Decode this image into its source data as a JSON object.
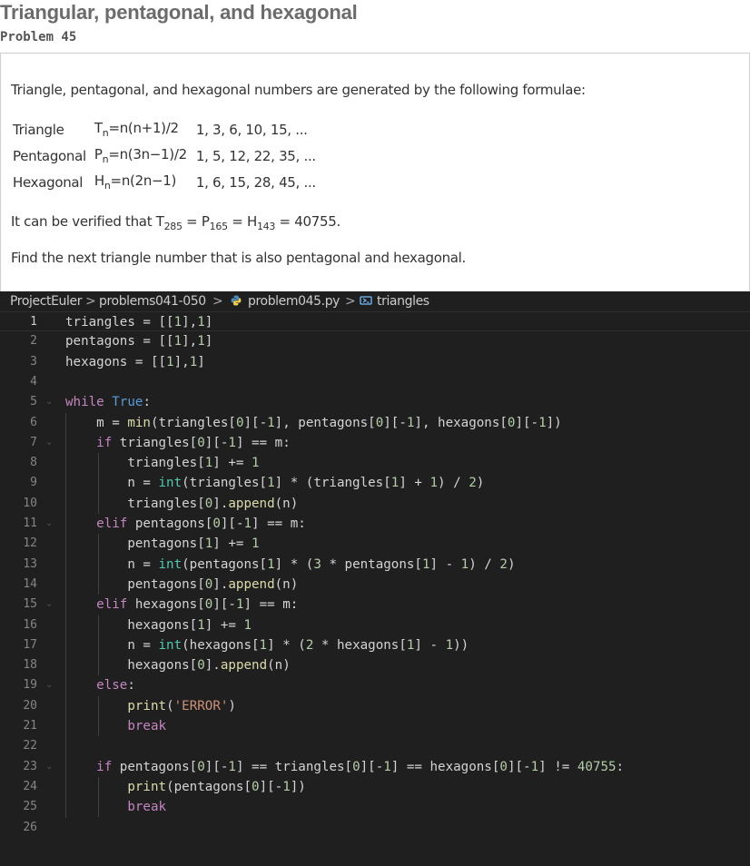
{
  "header": {
    "title": "Triangular, pentagonal, and hexagonal",
    "problem_label": "Problem 45"
  },
  "problem": {
    "intro": "Triangle, pentagonal, and hexagonal numbers are generated by the following formulae:",
    "formulae": [
      {
        "name": "Triangle",
        "letter": "T",
        "sub": "n",
        "formula": "=n(n+1)/2",
        "sequence": "1, 3, 6, 10, 15, ..."
      },
      {
        "name": "Pentagonal",
        "letter": "P",
        "sub": "n",
        "formula": "=n(3n−1)/2",
        "sequence": "1, 5, 12, 22, 35, ..."
      },
      {
        "name": "Hexagonal",
        "letter": "H",
        "sub": "n",
        "formula": "=n(2n−1)",
        "sequence": "1, 6, 15, 28, 45, ..."
      }
    ],
    "verify": {
      "prefix": "It can be verified that T",
      "t_sub": "285",
      "eq1": " = P",
      "p_sub": "165",
      "eq2": " = H",
      "h_sub": "143",
      "suffix": " = 40755."
    },
    "question": "Find the next triangle number that is also pentagonal and hexagonal."
  },
  "editor": {
    "breadcrumb": {
      "root": "ProjectEuler",
      "folder": "problems041-050",
      "file": "problem045.py",
      "symbol": "triangles",
      "separator": ">"
    },
    "active_line": 1,
    "colors": {
      "background": "#1f1f1f",
      "keyword": "#c586c0",
      "constant": "#569cd6",
      "function": "#dcdcaa",
      "builtin_type": "#4ec9b0",
      "number": "#b5cea8",
      "string": "#ce9178"
    },
    "lines": [
      "triangles = [[1],1]",
      "pentagons = [[1],1]",
      "hexagons = [[1],1]",
      "",
      "while True:",
      "    m = min(triangles[0][-1], pentagons[0][-1], hexagons[0][-1])",
      "    if triangles[0][-1] == m:",
      "        triangles[1] += 1",
      "        n = int(triangles[1] * (triangles[1] + 1) / 2)",
      "        triangles[0].append(n)",
      "    elif pentagons[0][-1] == m:",
      "        pentagons[1] += 1",
      "        n = int(pentagons[1] * (3 * pentagons[1] - 1) / 2)",
      "        pentagons[0].append(n)",
      "    elif hexagons[0][-1] == m:",
      "        hexagons[1] += 1",
      "        n = int(hexagons[1] * (2 * hexagons[1] - 1))",
      "        hexagons[0].append(n)",
      "    else:",
      "        print('ERROR')",
      "        break",
      "",
      "    if pentagons[0][-1] == triangles[0][-1] == hexagons[0][-1] != 40755:",
      "        print(pentagons[0][-1])",
      "        break",
      ""
    ],
    "fold_lines": [
      5,
      7,
      11,
      15,
      19,
      23
    ]
  }
}
